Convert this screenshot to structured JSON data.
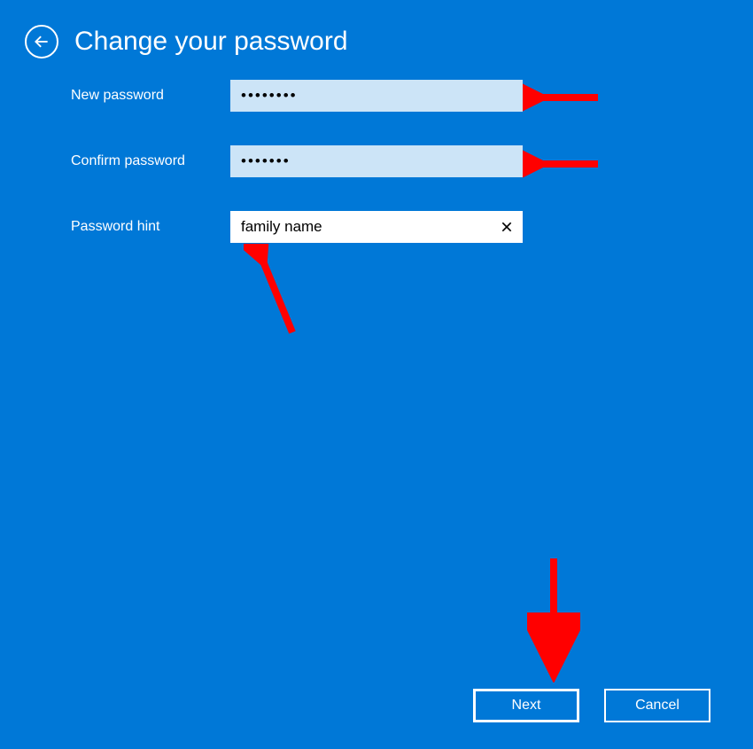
{
  "header": {
    "title": "Change your password"
  },
  "form": {
    "new_password": {
      "label": "New password",
      "value": "••••••••"
    },
    "confirm_password": {
      "label": "Confirm password",
      "value": "•••••••"
    },
    "password_hint": {
      "label": "Password hint",
      "value": "family name"
    }
  },
  "buttons": {
    "next": "Next",
    "cancel": "Cancel"
  }
}
